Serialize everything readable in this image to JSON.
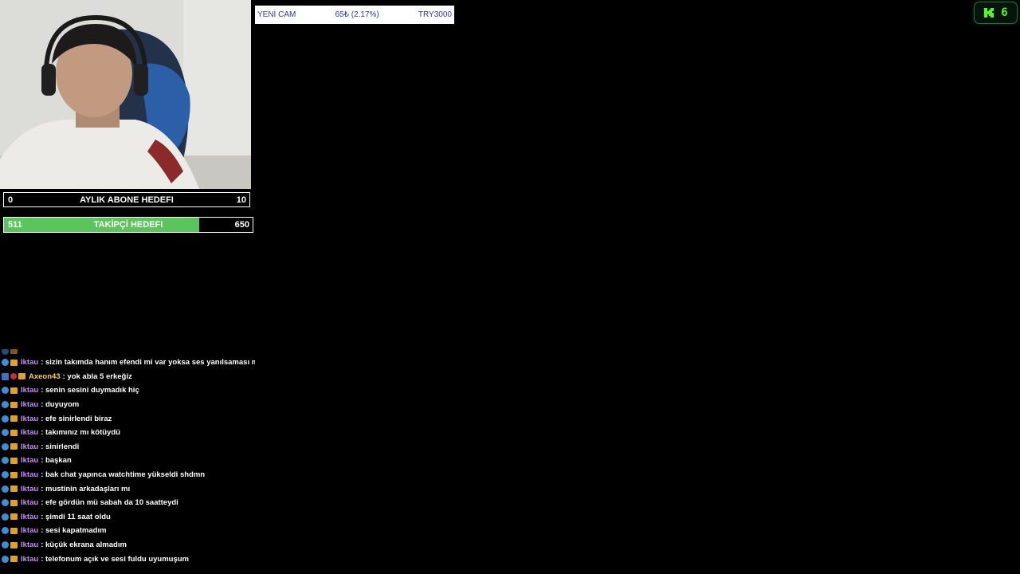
{
  "donation": {
    "label": "YENİ CAM",
    "amount": "65₺ (2.17%)",
    "goal": "TRY3000"
  },
  "subscriber_goal": {
    "min": "0",
    "title": "AYLIK ABONE HEDEFI",
    "max": "10"
  },
  "follower_goal": {
    "min": "511",
    "title": "TAKİPÇİ HEDEFI",
    "max": "650",
    "progress": 0.786
  },
  "kick": {
    "viewer_count": "6"
  },
  "chat": {
    "messages": [
      {
        "user": "Iktau",
        "text": ": sizin takımda hanım efendi mi var yoksa ses yanılsaması mı"
      },
      {
        "user": "Axeon43",
        "text": ": yok abla 5 erkeğiz"
      },
      {
        "user": "Iktau",
        "text": ": senin sesini duymadık hiç"
      },
      {
        "user": "Iktau",
        "text": ": duyuyom"
      },
      {
        "user": "Iktau",
        "text": ": efe sinirlendi biraz"
      },
      {
        "user": "Iktau",
        "text": ": takımınız mı kötüydü"
      },
      {
        "user": "Iktau",
        "text": ": sinirlendi"
      },
      {
        "user": "Iktau",
        "text": ": başkan"
      },
      {
        "user": "Iktau",
        "text": ": bak chat yapınca watchtime yükseldi shdmn"
      },
      {
        "user": "Iktau",
        "text": ": mustinin arkadaşları mı"
      },
      {
        "user": "Iktau",
        "text": ": efe gördün mü sabah da 10 saatteydi"
      },
      {
        "user": "Iktau",
        "text": ": şimdi 11 saat oldu"
      },
      {
        "user": "Iktau",
        "text": ": sesi kapatmadım"
      },
      {
        "user": "Iktau",
        "text": ": küçük ekrana almadım"
      },
      {
        "user": "Iktau",
        "text": ": telefonum açık ve sesi fuldu uyumuşum"
      }
    ]
  }
}
